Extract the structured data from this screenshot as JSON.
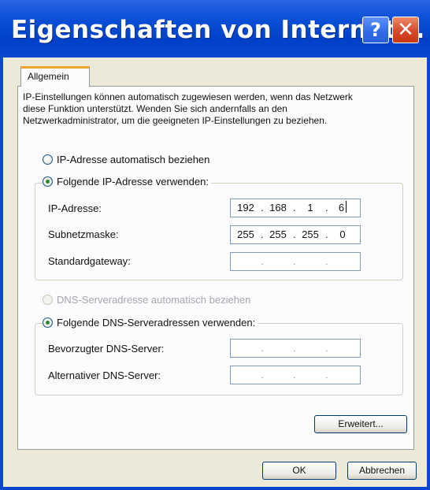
{
  "window": {
    "title": "Eigenschaften von Internet...",
    "help_label": "?",
    "close_label": "✕"
  },
  "tabs": [
    {
      "label": "Allgemein"
    }
  ],
  "description": "IP-Einstellungen können automatisch zugewiesen werden, wenn das Netzwerk diese Funktion unterstützt. Wenden Sie sich andernfalls an den Netzwerkadministrator, um die geeigneten IP-Einstellungen zu beziehen.",
  "ip": {
    "auto_label": "IP-Adresse automatisch beziehen",
    "manual_label": "Folgende IP-Adresse verwenden:",
    "selected": "manual",
    "fields": [
      {
        "label": "IP-Adresse:",
        "octets": [
          "192",
          "168",
          "1",
          "6"
        ]
      },
      {
        "label": "Subnetzmaske:",
        "octets": [
          "255",
          "255",
          "255",
          "0"
        ]
      },
      {
        "label": "Standardgateway:",
        "octets": [
          "",
          "",
          "",
          ""
        ]
      }
    ]
  },
  "dns": {
    "auto_label": "DNS-Serveradresse automatisch beziehen",
    "manual_label": "Folgende DNS-Serveradressen verwenden:",
    "selected": "manual",
    "fields": [
      {
        "label": "Bevorzugter DNS-Server:",
        "octets": [
          "",
          "",
          "",
          ""
        ]
      },
      {
        "label": "Alternativer DNS-Server:",
        "octets": [
          "",
          "",
          "",
          ""
        ]
      }
    ]
  },
  "buttons": {
    "advanced": "Erweitert...",
    "ok": "OK",
    "cancel": "Abbrechen"
  },
  "colors": {
    "titlebar": "#0a47cf",
    "tab_accent": "#f0a22f",
    "window_bg": "#ece9d8"
  }
}
